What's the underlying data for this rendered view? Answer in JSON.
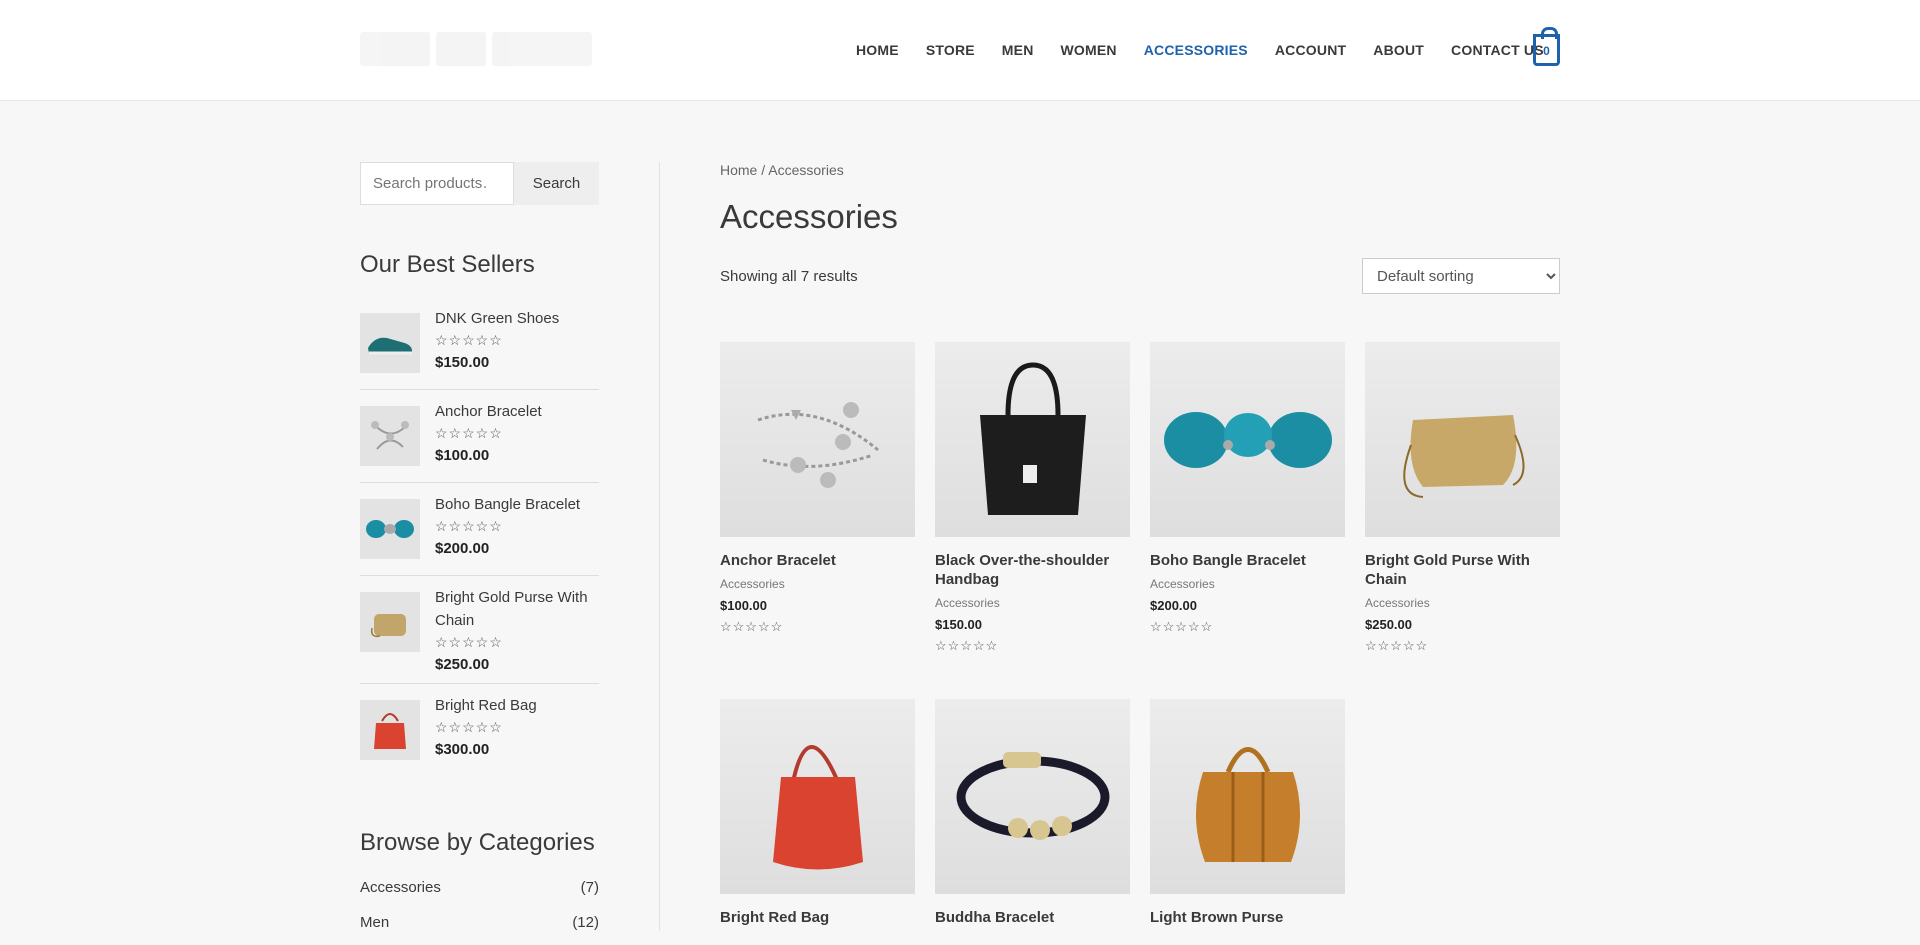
{
  "header": {
    "nav": [
      {
        "label": "HOME"
      },
      {
        "label": "STORE"
      },
      {
        "label": "MEN"
      },
      {
        "label": "WOMEN"
      },
      {
        "label": "ACCESSORIES"
      },
      {
        "label": "ACCOUNT"
      },
      {
        "label": "ABOUT"
      },
      {
        "label": "CONTACT US"
      }
    ],
    "active_nav": "ACCESSORIES",
    "cart_count": "0",
    "accent_color": "#1e62ae"
  },
  "sidebar": {
    "search_placeholder": "Search products…",
    "search_button": "Search",
    "best_sellers_title": "Our Best Sellers",
    "best_sellers": [
      {
        "name": "DNK Green Shoes",
        "price": "$150.00",
        "stars": "☆☆☆☆☆",
        "icon": "shoe-icon"
      },
      {
        "name": "Anchor Bracelet",
        "price": "$100.00",
        "stars": "☆☆☆☆☆",
        "icon": "bracelet-icon"
      },
      {
        "name": "Boho Bangle Bracelet",
        "price": "$200.00",
        "stars": "☆☆☆☆☆",
        "icon": "bangle-icon"
      },
      {
        "name": "Bright Gold Purse With Chain",
        "price": "$250.00",
        "stars": "☆☆☆☆☆",
        "icon": "purse-icon"
      },
      {
        "name": "Bright Red Bag",
        "price": "$300.00",
        "stars": "☆☆☆☆☆",
        "icon": "bag-icon"
      }
    ],
    "categories_title": "Browse by Categories",
    "categories": [
      {
        "name": "Accessories",
        "count": "(7)"
      },
      {
        "name": "Men",
        "count": "(12)"
      }
    ]
  },
  "main": {
    "breadcrumb_home": "Home",
    "breadcrumb_sep": " / ",
    "breadcrumb_current": "Accessories",
    "title": "Accessories",
    "result_count": "Showing all 7 results",
    "sort_selected": "Default sorting",
    "products": [
      {
        "name": "Anchor Bracelet",
        "category": "Accessories",
        "price": "$100.00",
        "stars": "☆☆☆☆☆"
      },
      {
        "name": "Black Over-the-shoulder Handbag",
        "category": "Accessories",
        "price": "$150.00",
        "stars": "☆☆☆☆☆"
      },
      {
        "name": "Boho Bangle Bracelet",
        "category": "Accessories",
        "price": "$200.00",
        "stars": "☆☆☆☆☆"
      },
      {
        "name": "Bright Gold Purse With Chain",
        "category": "Accessories",
        "price": "$250.00",
        "stars": "☆☆☆☆☆"
      },
      {
        "name": "Bright Red Bag",
        "category": "",
        "price": "",
        "stars": ""
      },
      {
        "name": "Buddha Bracelet",
        "category": "",
        "price": "",
        "stars": ""
      },
      {
        "name": "Light Brown Purse",
        "category": "",
        "price": "",
        "stars": ""
      }
    ]
  }
}
